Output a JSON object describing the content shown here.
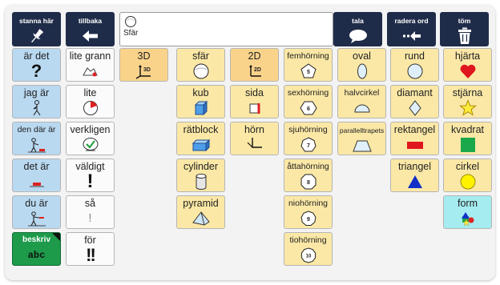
{
  "toolbar": {
    "pin": {
      "label": "stanna här",
      "icon": "pin-icon"
    },
    "back": {
      "label": "tillbaka",
      "icon": "arrow-left-icon"
    },
    "speak": {
      "label": "tala",
      "icon": "speech-bubble-icon"
    },
    "delete_word": {
      "label": "radera ord",
      "icon": "backspace-icon"
    },
    "clear": {
      "label": "töm",
      "icon": "trash-icon"
    }
  },
  "message": {
    "words": [
      "Sfär"
    ]
  },
  "cells": {
    "ar_det": "är det",
    "lite_grann": "lite grann",
    "d3": "3D",
    "sfar": "sfär",
    "d2": "2D",
    "femhorning": "femhörning",
    "oval": "oval",
    "rund": "rund",
    "hjarta": "hjärta",
    "jag_ar": "jag är",
    "lite": "lite",
    "kub": "kub",
    "sida": "sida",
    "sexhorning": "sexhörning",
    "halvcirkel": "halvcirkel",
    "diamant": "diamant",
    "stjarna": "stjärna",
    "den_dar_ar": "den där är",
    "verkligen": "verkligen",
    "ratblock": "rätblock",
    "horn": "hörn",
    "sjuhorning": "sjuhörning",
    "parallelltrapets": "parallelltrapets",
    "rektangel": "rektangel",
    "kvadrat": "kvadrat",
    "det_ar": "det är",
    "valdigt": "väldigt",
    "cylinder": "cylinder",
    "attahorning": "åttahörning",
    "triangel": "triangel",
    "cirkel": "cirkel",
    "du_ar": "du är",
    "sa": "så",
    "pyramid": "pyramid",
    "niohorning": "niohörning",
    "form": "form",
    "beskriv": "beskriv",
    "beskriv_sub": "abc",
    "for": "för",
    "tiohorning": "tiohörning"
  },
  "icon_text": {
    "d3": "3D",
    "d2": "2D",
    "n5": "5",
    "n6": "6",
    "n7": "7",
    "n8": "8",
    "n9": "9",
    "n10": "10",
    "question": "?",
    "excl": "!",
    "excl_double": "!!"
  },
  "colors": {
    "toolbar": "#1f2c49",
    "pronoun_blue": "#b9d9f1",
    "neutral_white": "#fbfbfb",
    "shape_yellow": "#fbe8a6",
    "dimension_orange": "#fad38a",
    "form_cyan": "#a4ecf0",
    "describe_green": "#1d9a4a",
    "heart_red": "#e0161e",
    "star_yellow": "#ffeb3b",
    "square_green": "#1aa84a",
    "triangle_blue": "#1230c8",
    "circle_yellow": "#fff200"
  }
}
